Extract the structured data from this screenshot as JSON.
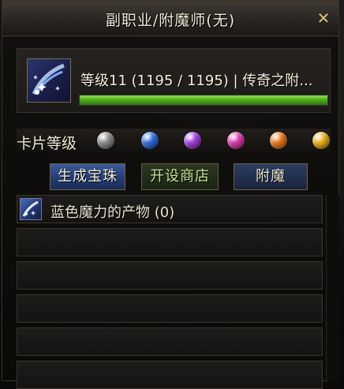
{
  "window": {
    "title": "副职业/附魔师(无)",
    "close_icon": "✕"
  },
  "profession": {
    "icon": "enchant-skill-icon",
    "level_text": "等级11 (1195 / 1195) | 传奇之附...",
    "exp_current": 1195,
    "exp_max": 1195,
    "exp_bar_color": "#5fbf25"
  },
  "card_level": {
    "label": "卡片等级",
    "orbs": [
      {
        "name": "gray-orb",
        "color": "#8e8e8e"
      },
      {
        "name": "blue-orb",
        "color": "#2f6fe0"
      },
      {
        "name": "purple-orb",
        "color": "#a540e0"
      },
      {
        "name": "pink-orb",
        "color": "#e040b0"
      },
      {
        "name": "orange-orb",
        "color": "#f07a20"
      },
      {
        "name": "gold-orb",
        "color": "#f2b21e"
      }
    ]
  },
  "tabs": {
    "generate_label": "生成宝珠",
    "shop_label": "开设商店",
    "enchant_label": "附魔"
  },
  "list": {
    "items": [
      {
        "label": "蓝色魔力的产物 (0)",
        "icon": "blue-magic-item-icon"
      },
      {
        "label": ""
      },
      {
        "label": ""
      },
      {
        "label": ""
      },
      {
        "label": ""
      },
      {
        "label": ""
      }
    ]
  }
}
